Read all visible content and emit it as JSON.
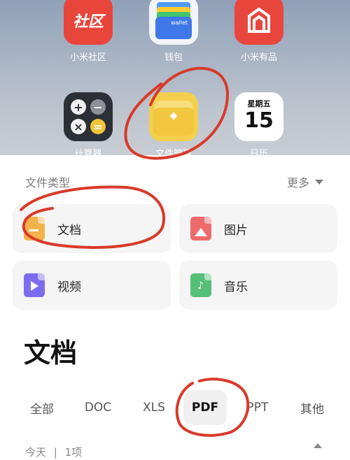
{
  "home": {
    "apps_row1": [
      {
        "label": "小米社区",
        "icon": "community-icon",
        "glyph": "社区"
      },
      {
        "label": "钱包",
        "icon": "wallet-icon",
        "glyph": "wallet"
      },
      {
        "label": "小米有品",
        "icon": "youpin-icon"
      }
    ],
    "apps_row2": [
      {
        "label": "计算器",
        "icon": "calculator-icon"
      },
      {
        "label": "文件管理",
        "icon": "file-manager-icon"
      },
      {
        "label": "日历",
        "icon": "calendar-icon",
        "weekday": "星期五",
        "day": "15"
      }
    ]
  },
  "file_types": {
    "title": "文件类型",
    "more_label": "更多",
    "categories": [
      {
        "label": "文档",
        "icon": "document-icon",
        "color": "#f3b24a"
      },
      {
        "label": "图片",
        "icon": "image-icon",
        "color": "#ef6a6a"
      },
      {
        "label": "视频",
        "icon": "video-icon",
        "color": "#7c6cf0"
      },
      {
        "label": "音乐",
        "icon": "music-icon",
        "color": "#56c079"
      }
    ]
  },
  "documents": {
    "title": "文档",
    "tabs": [
      {
        "label": "全部",
        "active": false
      },
      {
        "label": "DOC",
        "active": false
      },
      {
        "label": "XLS",
        "active": false
      },
      {
        "label": "PDF",
        "active": true
      },
      {
        "label": "PPT",
        "active": false
      },
      {
        "label": "其他",
        "active": false
      }
    ],
    "group_date": "今天",
    "group_separator": "|",
    "group_count": "1项"
  },
  "colors": {
    "annotation": "#d83a2a",
    "accent_red": "#e8463b"
  }
}
